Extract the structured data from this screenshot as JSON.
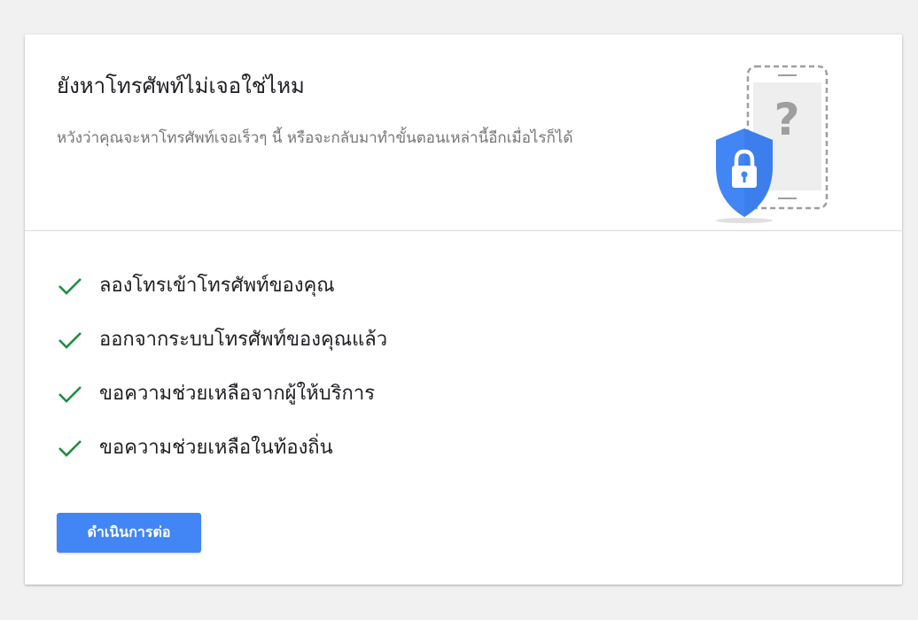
{
  "header": {
    "title": "ยังหาโทรศัพท์ไม่เจอใช่ไหม",
    "subtitle": "หวังว่าคุณจะหาโทรศัพท์เจอเร็วๆ นี้ หรือจะกลับมาทำขั้นตอนเหล่านี้อีกเมื่อไรก็ได้"
  },
  "illustration": {
    "icon": "lost-phone-shield-lock-icon",
    "question_mark": "?"
  },
  "steps": [
    {
      "label": "ลองโทรเข้าโทรศัพท์ของคุณ",
      "icon": "checkmark-icon"
    },
    {
      "label": "ออกจากระบบโทรศัพท์ของคุณแล้ว",
      "icon": "checkmark-icon"
    },
    {
      "label": "ขอความช่วยเหลือจากผู้ให้บริการ",
      "icon": "checkmark-icon"
    },
    {
      "label": "ขอความช่วยเหลือในท้องถิ่น",
      "icon": "checkmark-icon"
    }
  ],
  "actions": {
    "continue_label": "ดำเนินการต่อ"
  },
  "colors": {
    "page_background": "#f1f1f1",
    "card_background": "#ffffff",
    "accent_blue": "#4285f4",
    "check_green": "#1e8e3e",
    "title_text": "#202124",
    "subtitle_text": "#757575",
    "divider": "#dadce0"
  }
}
